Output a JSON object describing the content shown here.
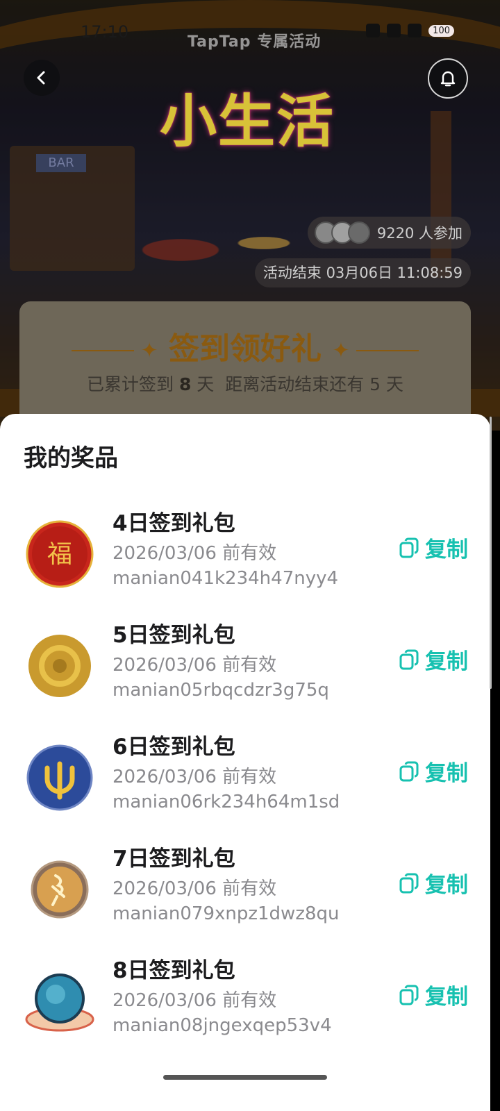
{
  "status": {
    "time": "17:10",
    "brand": "TapTap 专属活动",
    "battery": "100"
  },
  "hero": {
    "title": "小生活",
    "bar_sign": "BAR",
    "participants": "9220 人参加",
    "end_time": "活动结束 03月06日 11:08:59"
  },
  "checkin": {
    "title": "签到领好礼",
    "summary_prefix": "已累计签到",
    "days": "8",
    "summary_suffix": "天",
    "remaining": "距离活动结束还有 5 天"
  },
  "sheet": {
    "title": "我的奖品",
    "copy_label": "复制",
    "prizes": [
      {
        "name": "4日签到礼包",
        "valid": "2026/03/06 前有效",
        "code": "manian041k234h47nyy4",
        "icon": "fu-coin-icon"
      },
      {
        "name": "5日签到礼包",
        "valid": "2026/03/06 前有效",
        "code": "manian05rbqcdzr3g75q",
        "icon": "gold-coin-icon"
      },
      {
        "name": "6日签到礼包",
        "valid": "2026/03/06 前有效",
        "code": "manian06rk234h64m1sd",
        "icon": "trident-coin-icon"
      },
      {
        "name": "7日签到礼包",
        "valid": "2026/03/06 前有效",
        "code": "manian079xnpz1dwz8qu",
        "icon": "glyph-coin-icon"
      },
      {
        "name": "8日签到礼包",
        "valid": "2026/03/06 前有效",
        "code": "manian08jngexqep53v4",
        "icon": "crystal-ball-icon"
      }
    ]
  },
  "colors": {
    "accent": "#17c1b0",
    "title_gold": "#d8c238"
  }
}
